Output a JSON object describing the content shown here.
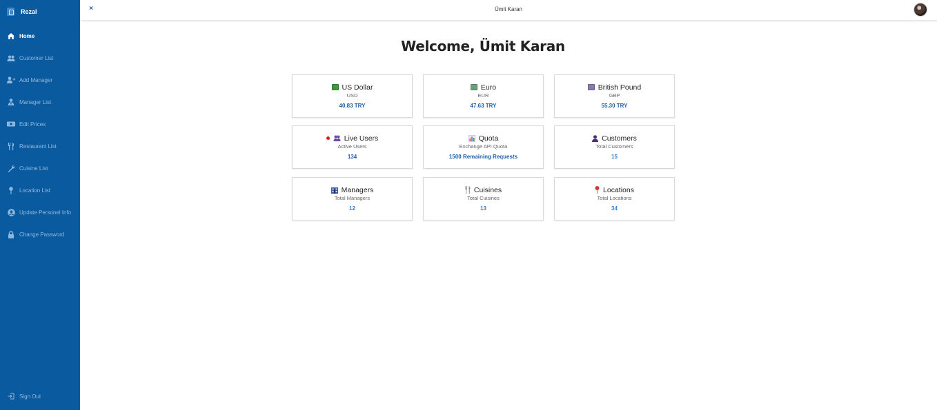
{
  "app": {
    "brand_name": "Rezal"
  },
  "sidebar": {
    "items": [
      {
        "label": "Home",
        "icon": "home-icon",
        "active": true
      },
      {
        "label": "Customer List",
        "icon": "users-icon"
      },
      {
        "label": "Add Manager",
        "icon": "user-plus-icon"
      },
      {
        "label": "Manager List",
        "icon": "user-tie-icon"
      },
      {
        "label": "Edit Prices",
        "icon": "money-icon"
      },
      {
        "label": "Restaurant List",
        "icon": "utensils-icon"
      },
      {
        "label": "Cuisine List",
        "icon": "wrench-icon"
      },
      {
        "label": "Location List",
        "icon": "map-pin-icon"
      },
      {
        "label": "Update Personel Info",
        "icon": "user-circle-icon"
      },
      {
        "label": "Change Password",
        "icon": "lock-icon"
      }
    ],
    "sign_out": "Sign Out"
  },
  "topbar": {
    "close": "×",
    "user_name": "Ümit Karan"
  },
  "main": {
    "welcome": "Welcome, Ümit Karan",
    "cards": [
      {
        "title": "US Dollar",
        "subtitle": "USD",
        "value": "40.83 TRY",
        "icon": "banknote-green-icon",
        "icon_color": "#3a9d3a"
      },
      {
        "title": "Euro",
        "subtitle": "EUR",
        "value": "47.63 TRY",
        "icon": "banknote-euro-icon",
        "icon_color": "#6aa07a"
      },
      {
        "title": "British Pound",
        "subtitle": "GBP",
        "value": "55.30 TRY",
        "icon": "banknote-pound-icon",
        "icon_color": "#8a7aa8"
      },
      {
        "title": "Live Users",
        "subtitle": "Active Users",
        "value": "134",
        "icon": "users-icon",
        "icon_color": "#6b4aa6",
        "live_dot_color": "#e01b1b"
      },
      {
        "title": "Quota",
        "subtitle": "Exchange API Quota",
        "value": "1500 Remaining Requests",
        "icon": "bar-chart-icon",
        "icon_color": "#7b6aa0"
      },
      {
        "title": "Customers",
        "subtitle": "Total Customers",
        "value": "15",
        "icon": "user-icon",
        "icon_color": "#4b2e7a"
      },
      {
        "title": "Managers",
        "subtitle": "Total Managers",
        "value": "12",
        "icon": "building-icon",
        "icon_color": "#3b5ba8"
      },
      {
        "title": "Cuisines",
        "subtitle": "Total Cuisines",
        "value": "13",
        "icon": "fork-knife-icon",
        "icon_color": "#8a8a8a"
      },
      {
        "title": "Locations",
        "subtitle": "Total Locations",
        "value": "34",
        "icon": "pushpin-icon",
        "icon_color": "#d23a3a"
      }
    ]
  },
  "colors": {
    "sidebar_bg": "#0a5aa0",
    "accent": "#1e5fa8",
    "value_blue": "#2f7fd6"
  }
}
